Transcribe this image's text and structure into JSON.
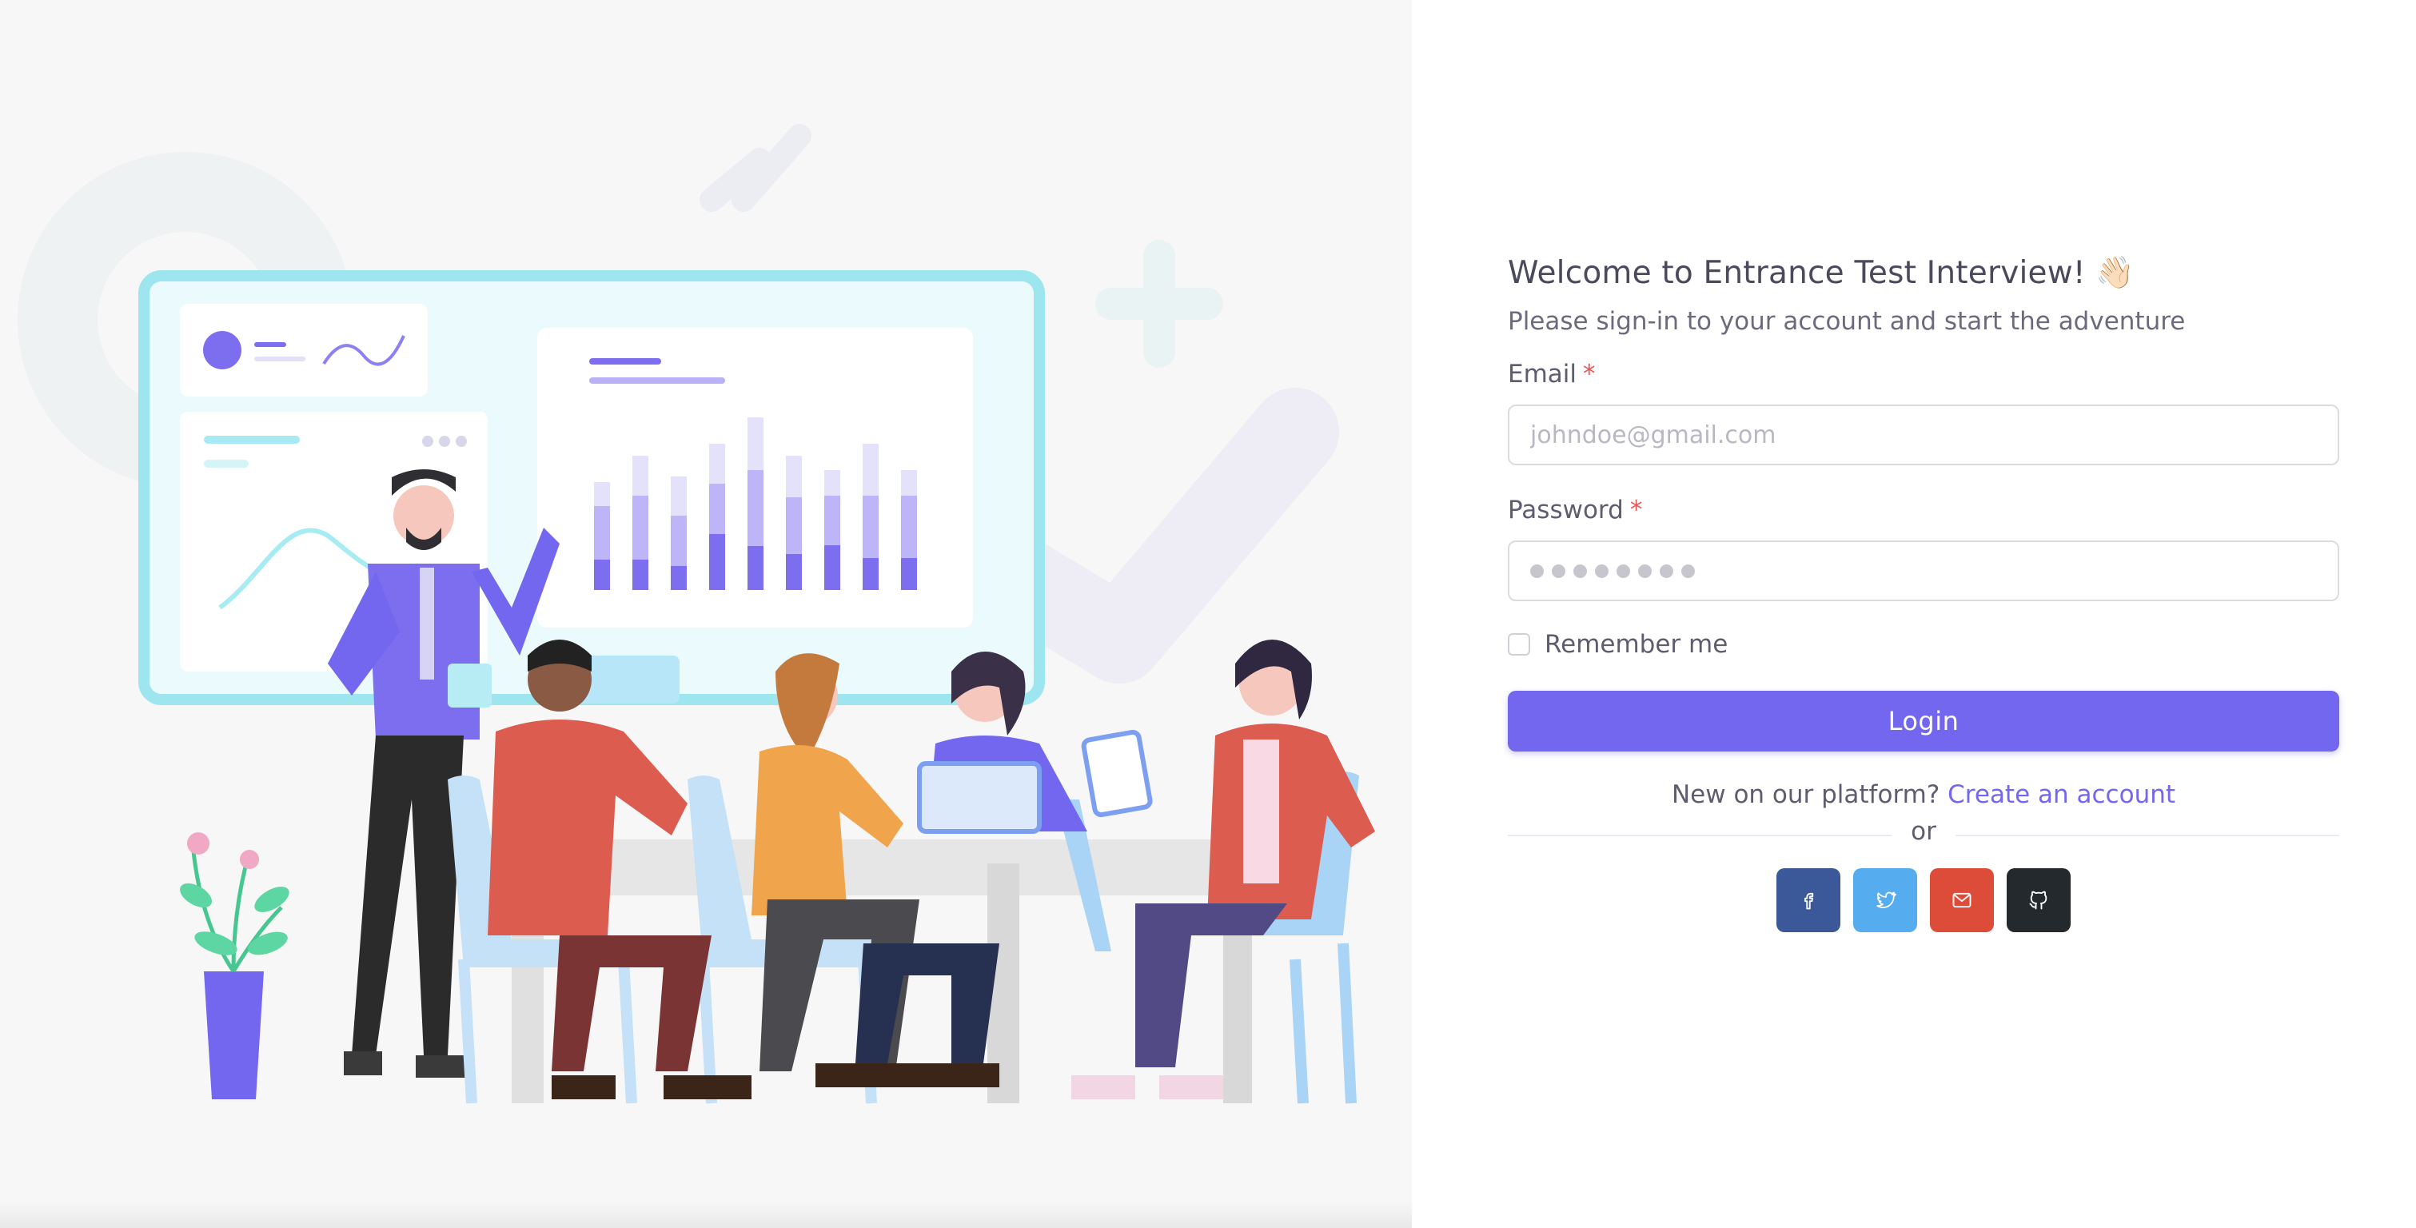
{
  "login": {
    "title": "Welcome to Entrance Test Interview! 👋🏻",
    "subtitle": "Please sign-in to your account and start the adventure",
    "email_label": "Email",
    "required_mark": "*",
    "email_placeholder": "johndoe@gmail.com",
    "password_label": "Password",
    "password_mask_count": 8,
    "remember_label": "Remember me",
    "remember_checked": false,
    "login_button": "Login",
    "new_user_text": "New on our platform?",
    "create_account_link": "Create an account",
    "divider_text": "or"
  },
  "social_buttons": [
    {
      "name": "facebook",
      "icon": "facebook-icon",
      "color": "#3b5998"
    },
    {
      "name": "twitter",
      "icon": "twitter-icon",
      "color": "#55acee"
    },
    {
      "name": "email",
      "icon": "mail-icon",
      "color": "#dd4b39"
    },
    {
      "name": "github",
      "icon": "github-icon",
      "color": "#24292e"
    }
  ],
  "colors": {
    "primary": "#7367f0",
    "required": "#ea5455",
    "left_background": "#f7f7f8"
  }
}
